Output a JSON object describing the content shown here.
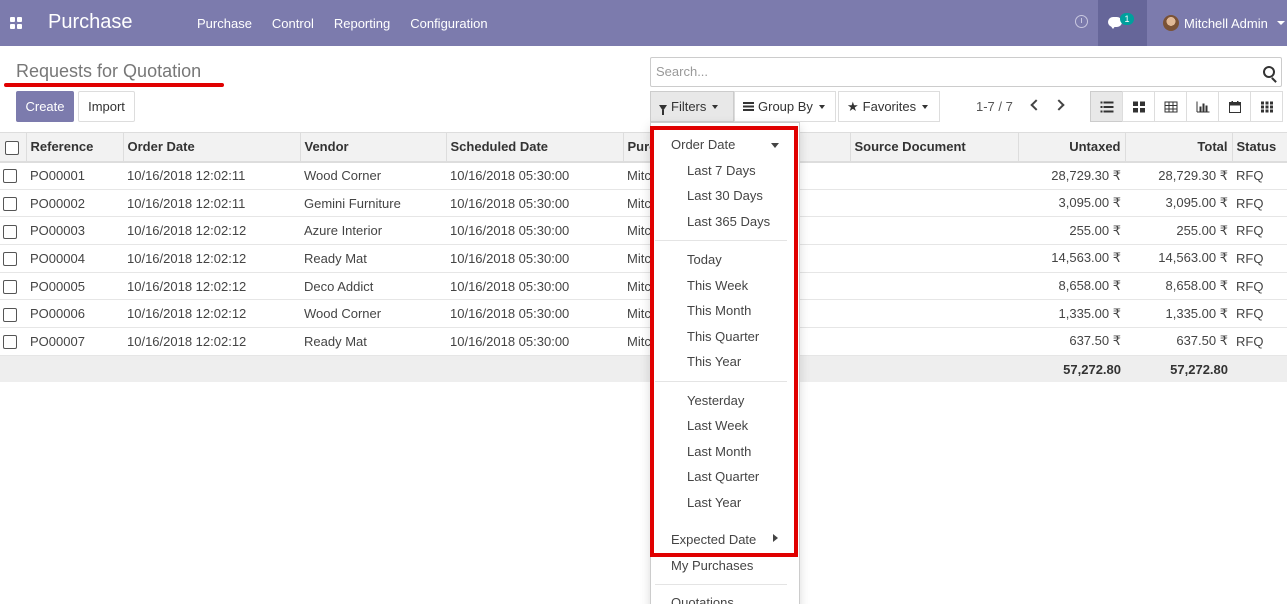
{
  "navbar": {
    "app_name": "Purchase",
    "menu": [
      "Purchase",
      "Control",
      "Reporting",
      "Configuration"
    ],
    "chat_badge": "1",
    "user_name": "Mitchell Admin"
  },
  "control_panel": {
    "title": "Requests for Quotation",
    "create_label": "Create",
    "import_label": "Import",
    "search_placeholder": "Search...",
    "filters_label": "Filters",
    "groupby_label": "Group By",
    "favorites_label": "Favorites",
    "pager": "1-7 / 7"
  },
  "table": {
    "columns": [
      "Reference",
      "Order Date",
      "Vendor",
      "Scheduled Date",
      "Purchase Representative",
      "Source Document",
      "Untaxed",
      "Total",
      "Status"
    ],
    "rows": [
      {
        "reference": "PO00001",
        "order_date": "10/16/2018 12:02:11",
        "vendor": "Wood Corner",
        "scheduled_date": "10/16/2018 05:30:00",
        "representative": "Mitchell Admin",
        "source": "",
        "untaxed": "28,729.30 ₹",
        "total": "28,729.30 ₹",
        "status": "RFQ"
      },
      {
        "reference": "PO00002",
        "order_date": "10/16/2018 12:02:11",
        "vendor": "Gemini Furniture",
        "scheduled_date": "10/16/2018 05:30:00",
        "representative": "Mitchell Admin",
        "source": "",
        "untaxed": "3,095.00 ₹",
        "total": "3,095.00 ₹",
        "status": "RFQ"
      },
      {
        "reference": "PO00003",
        "order_date": "10/16/2018 12:02:12",
        "vendor": "Azure Interior",
        "scheduled_date": "10/16/2018 05:30:00",
        "representative": "Mitchell Admin",
        "source": "",
        "untaxed": "255.00 ₹",
        "total": "255.00 ₹",
        "status": "RFQ"
      },
      {
        "reference": "PO00004",
        "order_date": "10/16/2018 12:02:12",
        "vendor": "Ready Mat",
        "scheduled_date": "10/16/2018 05:30:00",
        "representative": "Mitchell Admin",
        "source": "",
        "untaxed": "14,563.00 ₹",
        "total": "14,563.00 ₹",
        "status": "RFQ"
      },
      {
        "reference": "PO00005",
        "order_date": "10/16/2018 12:02:12",
        "vendor": "Deco Addict",
        "scheduled_date": "10/16/2018 05:30:00",
        "representative": "Mitchell Admin",
        "source": "",
        "untaxed": "8,658.00 ₹",
        "total": "8,658.00 ₹",
        "status": "RFQ"
      },
      {
        "reference": "PO00006",
        "order_date": "10/16/2018 12:02:12",
        "vendor": "Wood Corner",
        "scheduled_date": "10/16/2018 05:30:00",
        "representative": "Mitchell Admin",
        "source": "",
        "untaxed": "1,335.00 ₹",
        "total": "1,335.00 ₹",
        "status": "RFQ"
      },
      {
        "reference": "PO00007",
        "order_date": "10/16/2018 12:02:12",
        "vendor": "Ready Mat",
        "scheduled_date": "10/16/2018 05:30:00",
        "representative": "Mitchell Admin",
        "source": "",
        "untaxed": "637.50 ₹",
        "total": "637.50 ₹",
        "status": "RFQ"
      }
    ],
    "totals": {
      "untaxed": "57,272.80",
      "total": "57,272.80"
    }
  },
  "filters_menu": {
    "order_date_label": "Order Date",
    "group1": [
      "Last 7 Days",
      "Last 30 Days",
      "Last 365 Days"
    ],
    "group2": [
      "Today",
      "This Week",
      "This Month",
      "This Quarter",
      "This Year"
    ],
    "group3": [
      "Yesterday",
      "Last Week",
      "Last Month",
      "Last Quarter",
      "Last Year"
    ],
    "expected_date_label": "Expected Date",
    "my_purchases_label": "My Purchases",
    "quotations_label": "Quotations"
  },
  "colors": {
    "brand": "#7c7bad",
    "highlight": "#e00000"
  }
}
